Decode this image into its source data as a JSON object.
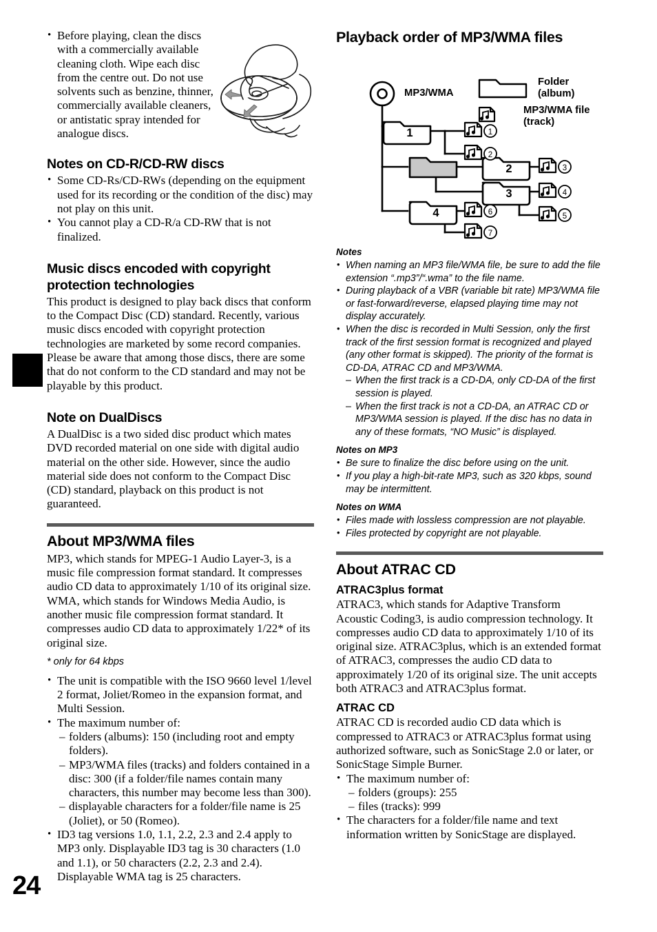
{
  "page": {
    "number": "24"
  },
  "left_column": {
    "intro_bullet": "Before playing, clean the discs with a commercially available cleaning cloth. Wipe each disc from the centre out. Do not use solvents such as benzine, thinner, commercially available cleaners, or antistatic spray intended for analogue discs.",
    "cdr_heading": "Notes on CD-R/CD-RW discs",
    "cdr_bullets": [
      "Some CD-Rs/CD-RWs (depending on the equipment used for its recording or the condition of the disc) may not play on this unit.",
      "You cannot play a CD-R/a CD-RW that is not finalized."
    ],
    "copyright_heading": "Music discs encoded with copyright protection technologies",
    "copyright_body": "This product is designed to play back discs that conform to the Compact Disc (CD) standard. Recently, various music discs encoded with copyright protection technologies are marketed by some record companies. Please be aware that among those discs, there are some that do not conform to the CD standard and may not be playable by this product.",
    "dualdisc_heading": "Note on DualDiscs",
    "dualdisc_body": "A DualDisc is a two sided disc product which mates DVD recorded material on one side with digital audio material on the other side. However, since the audio material side does not conform to the Compact Disc (CD) standard, playback on this product is not guaranteed.",
    "mp3wma_heading": "About MP3/WMA files",
    "mp3wma_body1": "MP3, which stands for MPEG-1 Audio Layer-3, is a music file compression format standard. It compresses audio CD data to approximately 1/10 of its original size.",
    "mp3wma_body2": "WMA, which stands for Windows Media Audio, is another music file compression format standard. It compresses audio CD data to approximately 1/22* of its original size.",
    "footnote": "* only for 64 kbps",
    "spec_bullet_1": "The unit is compatible with the ISO 9660 level 1/level 2 format, Joliet/Romeo in the expansion format, and Multi Session.",
    "spec_bullet_2": "The maximum number of:",
    "spec_sub": [
      "folders (albums): 150 (including root and empty folders).",
      "MP3/WMA files (tracks) and folders contained in a disc: 300 (if a folder/file names contain many characters, this number may become less than 300).",
      "displayable characters for a folder/file name is 25 (Joliet), or 50 (Romeo)."
    ],
    "spec_bullet_3": "ID3 tag versions 1.0, 1.1, 2.2, 2.3 and 2.4 apply to MP3 only. Displayable ID3 tag is 30 characters (1.0 and 1.1), or 50 characters (2.2, 2.3 and 2.4). Displayable WMA tag is 25 characters."
  },
  "right_column": {
    "playback_heading": "Playback order of MP3/WMA files",
    "diagram": {
      "root_label": "MP3/WMA",
      "legend": [
        {
          "icon": "folder-icon",
          "line1": "Folder",
          "line2": "(album)"
        },
        {
          "icon": "music-note-icon",
          "line1": "MP3/WMA file",
          "line2": "(track)"
        }
      ],
      "folders": [
        {
          "name": "1"
        },
        {
          "name": ""
        },
        {
          "name": "2"
        },
        {
          "name": "3"
        },
        {
          "name": "4"
        }
      ],
      "tracks": [
        "1",
        "2",
        "3",
        "4",
        "5",
        "6",
        "7"
      ]
    },
    "notes_heading": "Notes",
    "notes": [
      "When naming an MP3 file/WMA file, be sure to add the file extension “.mp3”/“.wma” to the file name.",
      "During playback of a VBR (variable bit rate) MP3/WMA file or fast-forward/reverse, elapsed playing time may not display accurately.",
      "When the disc is recorded in Multi Session, only the first track of the first session format is recognized and played (any other format is skipped). The priority of the format is CD-DA, ATRAC CD and MP3/WMA."
    ],
    "notes_sub": [
      "When the first track is a CD-DA, only CD-DA of the first session is played.",
      "When the first track is not a CD-DA, an ATRAC CD or MP3/WMA session is played. If the disc has no data in any of these formats, “NO Music” is displayed."
    ],
    "notes_mp3_heading": "Notes on MP3",
    "notes_mp3": [
      "Be sure to finalize the disc before using on the unit.",
      "If you play a high-bit-rate MP3, such as 320 kbps, sound may be intermittent."
    ],
    "notes_wma_heading": "Notes on WMA",
    "notes_wma": [
      "Files made with lossless compression are not playable.",
      "Files protected by copyright are not playable."
    ],
    "atrac_heading": "About ATRAC CD",
    "atrac3plus_heading": "ATRAC3plus format",
    "atrac3plus_body": "ATRAC3, which stands for Adaptive Transform Acoustic Coding3, is audio compression technology. It compresses audio CD data to approximately 1/10 of its original size. ATRAC3plus, which is an extended format of ATRAC3, compresses the audio CD data to approximately 1/20 of its original size. The unit accepts both ATRAC3 and ATRAC3plus format.",
    "atraccd_heading": "ATRAC CD",
    "atraccd_body": "ATRAC CD is recorded audio CD data which is compressed to ATRAC3 or ATRAC3plus format using authorized software, such as SonicStage 2.0 or later, or SonicStage Simple Burner.",
    "atraccd_bullet_1": "The maximum number of:",
    "atraccd_sub": [
      "folders (groups): 255",
      "files (tracks): 999"
    ],
    "atraccd_bullet_2": "The characters for a folder/file name and text information written by SonicStage are displayed."
  },
  "colors": {
    "rule": "#595959",
    "folder_highlight": "#c8c8c8",
    "ink": "#000000"
  }
}
